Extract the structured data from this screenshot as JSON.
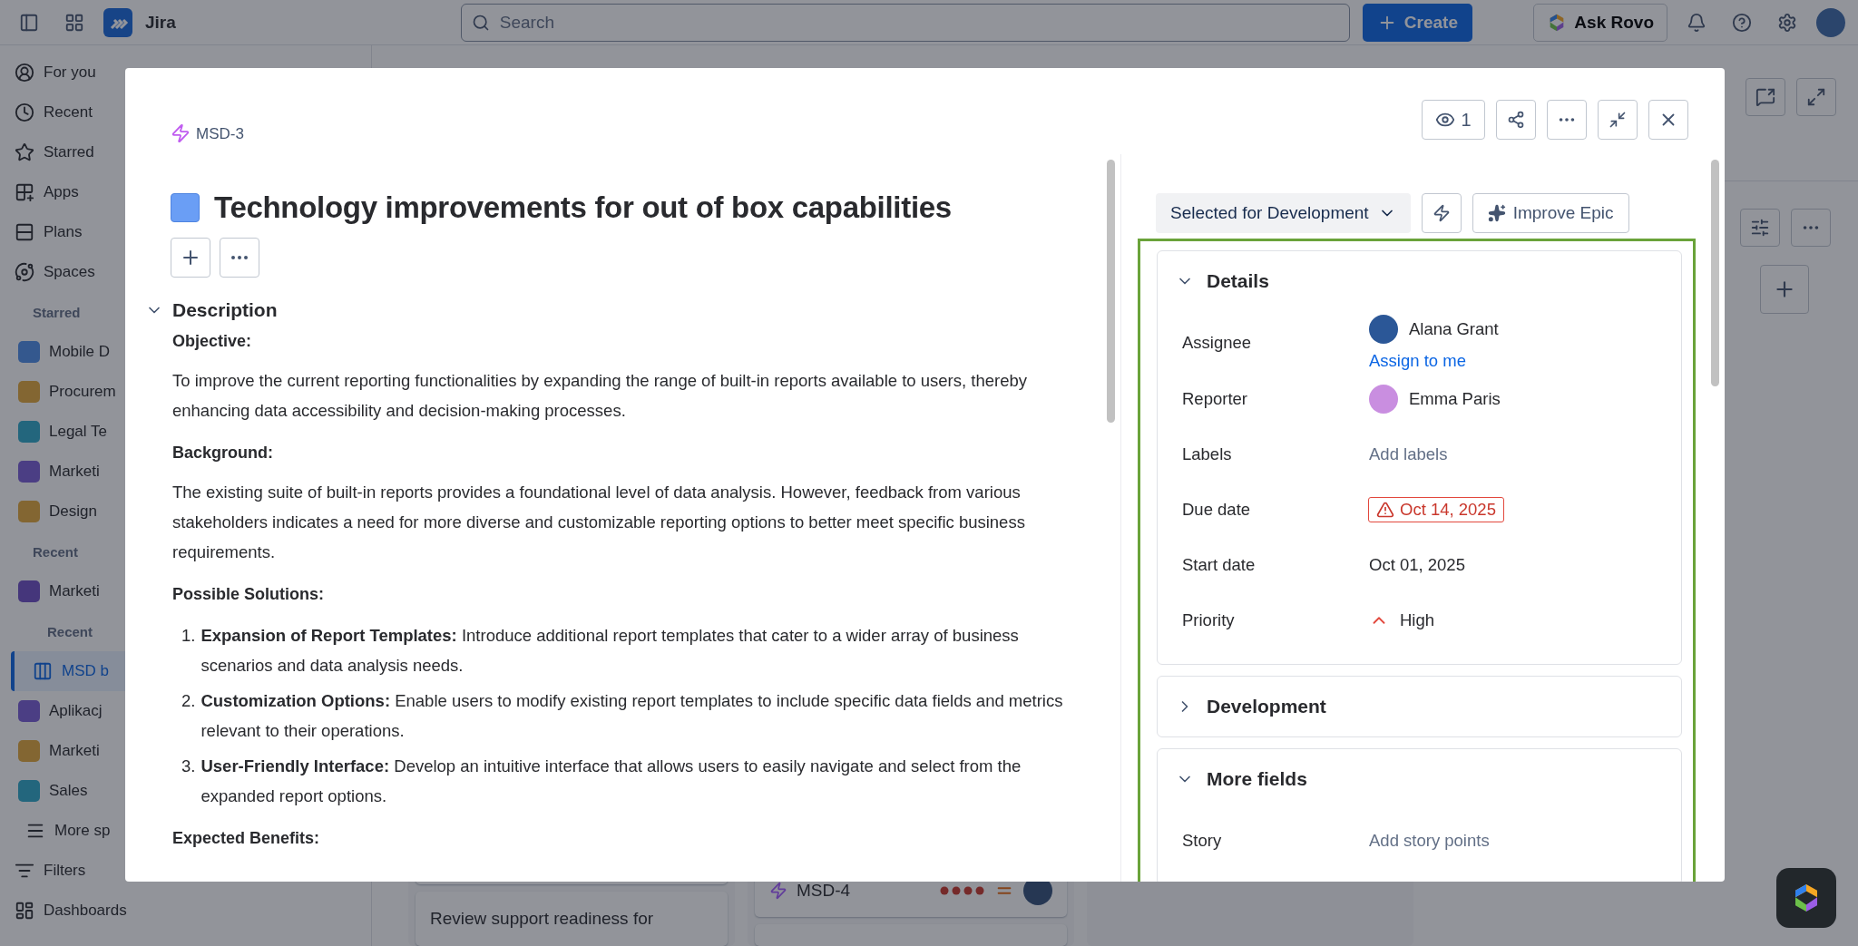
{
  "top_bar": {
    "product": "Jira",
    "search": {
      "placeholder": "Search"
    },
    "create": "Create",
    "ask": "Ask Rovo"
  },
  "sidebar": {
    "items": [
      {
        "kind": "nav",
        "label": "For you",
        "selected": false
      },
      {
        "kind": "nav",
        "label": "Recent",
        "selected": false
      },
      {
        "kind": "nav",
        "label": "Starred",
        "selected": false
      },
      {
        "kind": "nav",
        "label": "Apps",
        "selected": false
      },
      {
        "kind": "nav",
        "label": "Plans",
        "selected": false
      },
      {
        "kind": "nav",
        "label": "Spaces",
        "selected": false
      },
      {
        "kind": "heading",
        "label": "Starred"
      },
      {
        "kind": "space",
        "label": "Mobile D",
        "selected": false
      },
      {
        "kind": "space",
        "label": "Procurem",
        "selected": false
      },
      {
        "kind": "space",
        "label": "Legal Te",
        "selected": false
      },
      {
        "kind": "space",
        "label": "Marketi",
        "selected": false
      },
      {
        "kind": "space",
        "label": "Design",
        "selected": false
      },
      {
        "kind": "heading",
        "label": "Recent"
      },
      {
        "kind": "space",
        "label": "Marketi",
        "selected": false
      },
      {
        "kind": "subheading",
        "label": "Recent"
      },
      {
        "kind": "board",
        "label": "MSD b",
        "selected": true
      },
      {
        "kind": "space",
        "label": "Aplikacj",
        "selected": false
      },
      {
        "kind": "space",
        "label": "Marketi",
        "selected": false
      },
      {
        "kind": "space",
        "label": "Sales",
        "selected": false
      },
      {
        "kind": "more",
        "label": "More sp",
        "selected": false
      },
      {
        "kind": "filters",
        "label": "Filters",
        "selected": false
      },
      {
        "kind": "dashboards",
        "label": "Dashboards",
        "selected": false
      }
    ]
  },
  "board": {
    "columns": [
      {
        "cards": [
          {
            "kind": "blank"
          },
          {
            "kind": "title",
            "text": "Review support readiness for"
          }
        ]
      },
      {
        "cards": [
          {
            "kind": "issue",
            "key": "MSD-4"
          },
          {
            "kind": "blank"
          }
        ]
      }
    ]
  },
  "modal": {
    "issue_key": "MSD-3",
    "watchers": "1",
    "title": "Technology improvements for out of box capabilities",
    "description": {
      "heading": "Description",
      "expanded": true,
      "blocks": [
        {
          "kind": "heading",
          "text": "Objective:"
        },
        {
          "kind": "paragraph",
          "text": "To improve the current reporting functionalities by expanding the range of built-in reports available to users, thereby enhancing data accessibility and decision-making processes."
        },
        {
          "kind": "heading",
          "text": "Background:"
        },
        {
          "kind": "paragraph",
          "text": "The existing suite of built-in reports provides a foundational level of data analysis. However, feedback from various stakeholders indicates a need for more diverse and customizable reporting options to better meet specific business requirements."
        },
        {
          "kind": "heading",
          "text": "Possible Solutions:"
        },
        {
          "kind": "list",
          "items": [
            {
              "marker": "1.",
              "text": "**Expansion of Report Templates:** Introduce additional report templates that cater to a wider array of business scenarios and data analysis needs."
            },
            {
              "marker": "2.",
              "text": "**Customization Options:** Enable users to modify existing report templates to include specific data fields and metrics relevant to their operations."
            },
            {
              "marker": "3.",
              "text": "**User-Friendly Interface:** Develop an intuitive interface that allows users to easily navigate and select from the expanded report options."
            }
          ]
        },
        {
          "kind": "heading",
          "text": "Expected Benefits:"
        }
      ]
    },
    "status": "Selected for Development",
    "improve": "Improve Epic",
    "sections": [
      {
        "title": "Details",
        "expanded": true,
        "fields": [
          {
            "label": "Assignee",
            "kind": "person",
            "value": "Alana Grant",
            "action": "Assign to me"
          },
          {
            "label": "Reporter",
            "kind": "person",
            "value": "Emma Paris"
          },
          {
            "label": "Labels",
            "kind": "empty",
            "value": "Add labels"
          },
          {
            "label": "Due date",
            "kind": "date",
            "value": "Oct 14, 2025",
            "overdue": true
          },
          {
            "label": "Start date",
            "kind": "date",
            "value": "Oct 01, 2025",
            "overdue": false
          },
          {
            "label": "Priority",
            "kind": "priority",
            "value": "High"
          }
        ]
      },
      {
        "title": "Development",
        "expanded": false
      },
      {
        "title": "More fields",
        "expanded": true,
        "fields": [
          {
            "label": "Story",
            "kind": "empty",
            "value": "Add story points"
          }
        ]
      }
    ]
  }
}
